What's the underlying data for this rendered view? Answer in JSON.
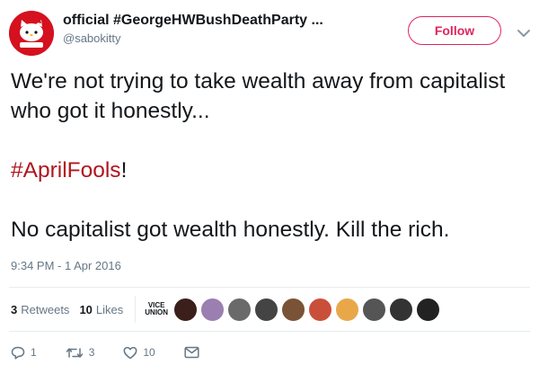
{
  "author": {
    "display_name": "official #GeorgeHWBushDeathParty ...",
    "screen_name": "@sabokitty",
    "avatar_label": "sabokitty"
  },
  "follow_button": {
    "label": "Follow"
  },
  "tweet": {
    "line1": "We're not trying to take wealth away from capitalist who got it honestly...",
    "hashtag": "#AprilFools",
    "hashtag_suffix": "!",
    "line3": "No capitalist got wealth honestly. Kill the rich.",
    "timestamp": "9:34 PM - 1 Apr 2016"
  },
  "stats": {
    "retweets_count": "3",
    "retweets_label": "Retweets",
    "likes_count": "10",
    "likes_label": "Likes",
    "vice_line1": "VICE",
    "vice_line2": "UNION"
  },
  "likers": [
    {
      "icon": "avatar",
      "color": "#3a1f1a"
    },
    {
      "icon": "avatar",
      "color": "#9a7fb0"
    },
    {
      "icon": "avatar",
      "color": "#6a6a6a"
    },
    {
      "icon": "avatar",
      "color": "#444444"
    },
    {
      "icon": "avatar",
      "color": "#7a5236"
    },
    {
      "icon": "avatar",
      "color": "#c94f3a"
    },
    {
      "icon": "avatar",
      "color": "#e8a84a"
    },
    {
      "icon": "avatar",
      "color": "#555555"
    },
    {
      "icon": "avatar",
      "color": "#333333"
    },
    {
      "icon": "avatar",
      "color": "#222222"
    }
  ],
  "actions": {
    "reply_count": "1",
    "retweet_count": "3",
    "like_count": "10"
  },
  "colors": {
    "accent": "#e0245e",
    "hashtag": "#b0151f",
    "muted": "#657786"
  }
}
